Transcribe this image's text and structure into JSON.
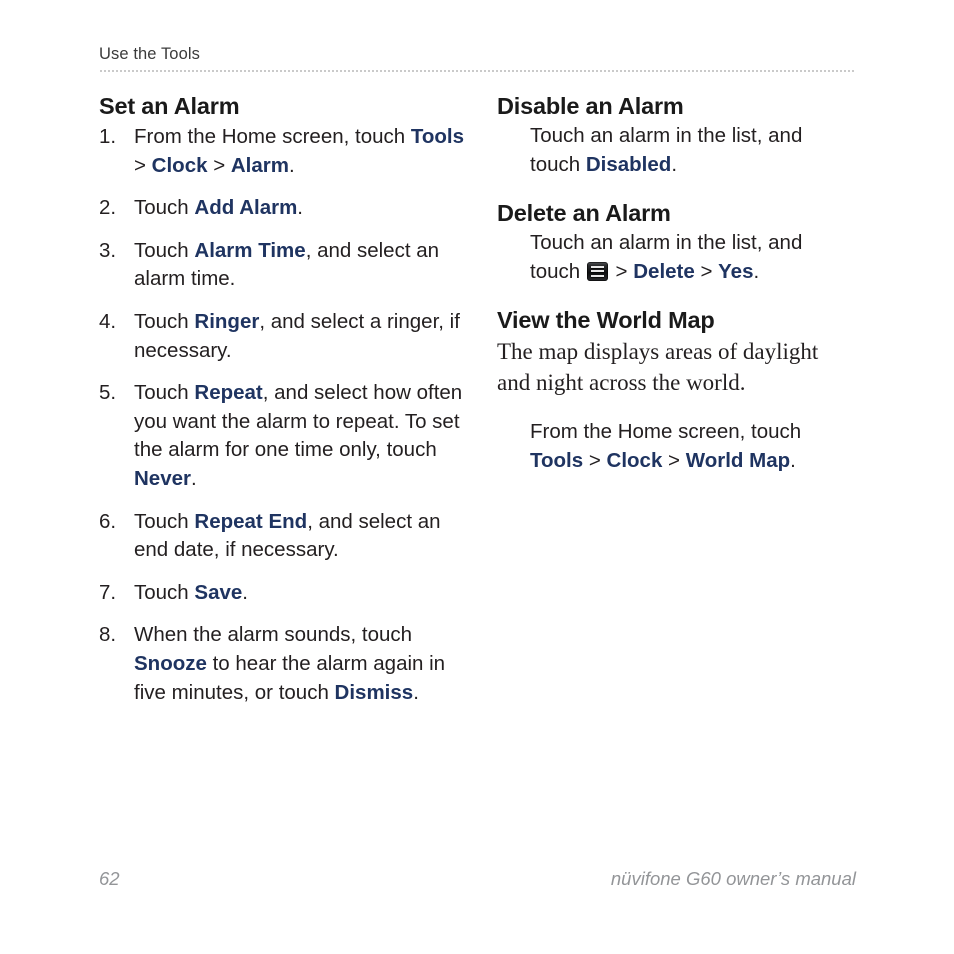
{
  "header": {
    "running_title": "Use the Tools"
  },
  "colors": {
    "keyword_blue": "#1f3461",
    "body_text": "#231f20",
    "footer_grey": "#939598",
    "rule_grey": "#9a9a9a"
  },
  "left_column": {
    "section_title": "Set an Alarm",
    "steps": [
      {
        "number": "1.",
        "parts": [
          {
            "type": "text",
            "value": "From the Home screen, touch "
          },
          {
            "type": "keyword",
            "value": "Tools"
          },
          {
            "type": "text",
            "value": " > "
          },
          {
            "type": "keyword",
            "value": "Clock"
          },
          {
            "type": "text",
            "value": " > "
          },
          {
            "type": "keyword",
            "value": "Alarm"
          },
          {
            "type": "text",
            "value": "."
          }
        ]
      },
      {
        "number": "2.",
        "parts": [
          {
            "type": "text",
            "value": "Touch "
          },
          {
            "type": "keyword",
            "value": "Add Alarm"
          },
          {
            "type": "text",
            "value": "."
          }
        ]
      },
      {
        "number": "3.",
        "parts": [
          {
            "type": "text",
            "value": "Touch "
          },
          {
            "type": "keyword",
            "value": "Alarm Time"
          },
          {
            "type": "text",
            "value": ", and select an alarm time."
          }
        ]
      },
      {
        "number": "4.",
        "parts": [
          {
            "type": "text",
            "value": "Touch "
          },
          {
            "type": "keyword",
            "value": "Ringer"
          },
          {
            "type": "text",
            "value": ", and select a ringer, if necessary."
          }
        ]
      },
      {
        "number": "5.",
        "parts": [
          {
            "type": "text",
            "value": "Touch "
          },
          {
            "type": "keyword",
            "value": "Repeat"
          },
          {
            "type": "text",
            "value": ", and select how often you want the alarm to repeat. To set the alarm for one time only, touch "
          },
          {
            "type": "keyword",
            "value": "Never"
          },
          {
            "type": "text",
            "value": "."
          }
        ]
      },
      {
        "number": "6.",
        "parts": [
          {
            "type": "text",
            "value": "Touch "
          },
          {
            "type": "keyword",
            "value": "Repeat End"
          },
          {
            "type": "text",
            "value": ", and select an end date, if necessary."
          }
        ]
      },
      {
        "number": "7.",
        "parts": [
          {
            "type": "text",
            "value": "Touch "
          },
          {
            "type": "keyword",
            "value": "Save"
          },
          {
            "type": "text",
            "value": "."
          }
        ]
      },
      {
        "number": "8.",
        "parts": [
          {
            "type": "text",
            "value": "When the alarm sounds, touch "
          },
          {
            "type": "keyword",
            "value": "Snooze"
          },
          {
            "type": "text",
            "value": " to hear the alarm again in five minutes, or touch "
          },
          {
            "type": "keyword",
            "value": "Dismiss"
          },
          {
            "type": "text",
            "value": "."
          }
        ]
      }
    ]
  },
  "right_column": {
    "sections": [
      {
        "id": "disable-an-alarm",
        "title": "Disable an Alarm",
        "body_style": "indent-sans",
        "parts": [
          {
            "type": "text",
            "value": "Touch an alarm in the list, and touch "
          },
          {
            "type": "keyword",
            "value": "Disabled"
          },
          {
            "type": "text",
            "value": "."
          }
        ]
      },
      {
        "id": "delete-an-alarm",
        "title": "Delete an Alarm",
        "body_style": "indent-sans",
        "parts": [
          {
            "type": "text",
            "value": "Touch an alarm in the list, and touch "
          },
          {
            "type": "icon",
            "value": "menu-icon"
          },
          {
            "type": "text",
            "value": " > "
          },
          {
            "type": "keyword",
            "value": "Delete"
          },
          {
            "type": "text",
            "value": " > "
          },
          {
            "type": "keyword",
            "value": "Yes"
          },
          {
            "type": "text",
            "value": "."
          }
        ]
      },
      {
        "id": "view-the-world-map",
        "title": "View the World Map",
        "body_style": "serif",
        "parts": [
          {
            "type": "text",
            "value": "The map displays areas of daylight and night across the world."
          }
        ],
        "follow_up": {
          "body_style": "indent-sans",
          "parts": [
            {
              "type": "text",
              "value": "From the Home screen, touch "
            },
            {
              "type": "keyword",
              "value": "Tools"
            },
            {
              "type": "text",
              "value": " > "
            },
            {
              "type": "keyword",
              "value": "Clock"
            },
            {
              "type": "text",
              "value": " > "
            },
            {
              "type": "keyword",
              "value": "World Map"
            },
            {
              "type": "text",
              "value": "."
            }
          ]
        }
      }
    ]
  },
  "footer": {
    "page_number": "62",
    "manual_title": "nüvifone G60 owner’s manual"
  }
}
